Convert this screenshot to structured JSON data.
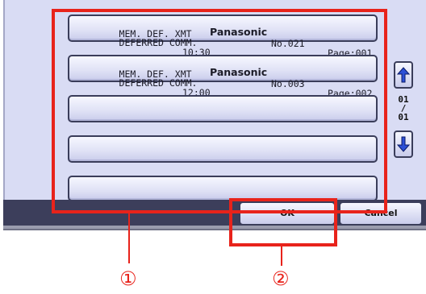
{
  "jobs": [
    {
      "line1": "MEM. DEF. XMT",
      "no": "No.021",
      "page": "Page:001",
      "line2": "DEFERRED COMM.",
      "time": "10:30",
      "maker": "Panasonic"
    },
    {
      "line1": "MEM. DEF. XMT",
      "no": "No.003",
      "page": "Page:002",
      "line2": "DEFERRED COMM.",
      "time": "12:00",
      "maker": "Panasonic"
    }
  ],
  "pager": {
    "current": "01",
    "separator": "/",
    "total": "01"
  },
  "buttons": {
    "ok": "OK",
    "cancel": "Cancel"
  },
  "callouts": {
    "one": "①",
    "two": "②"
  },
  "colors": {
    "highlight": "#e8231b",
    "panel": "#d9dcf4",
    "bar": "#3c3e5b"
  },
  "icons": {
    "scroll_up": "arrow-up-icon",
    "scroll_down": "arrow-down-icon"
  }
}
